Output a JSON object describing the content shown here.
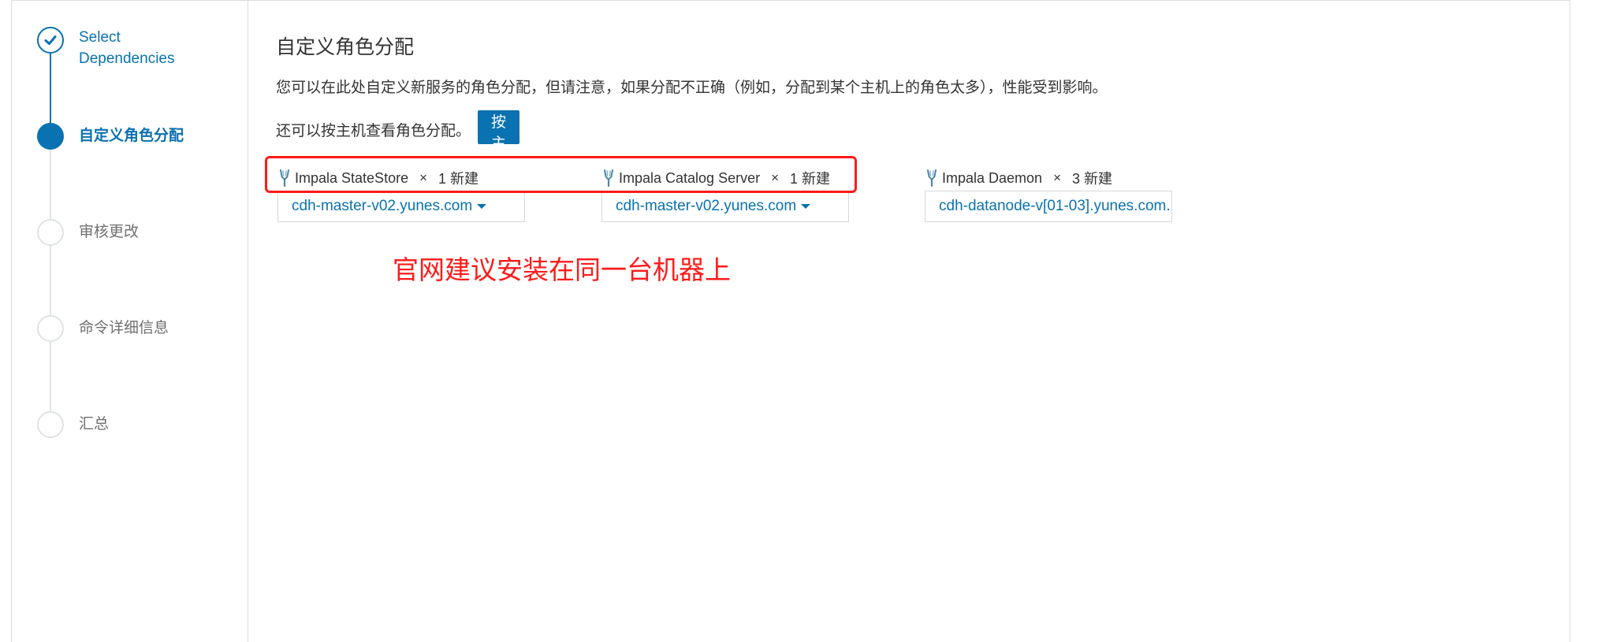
{
  "sidebar": {
    "steps": [
      {
        "label": "Select Dependencies",
        "state": "done"
      },
      {
        "label": "自定义角色分配",
        "state": "active"
      },
      {
        "label": "审核更改",
        "state": "todo"
      },
      {
        "label": "命令详细信息",
        "state": "todo"
      },
      {
        "label": "汇总",
        "state": "todo"
      }
    ]
  },
  "main": {
    "title": "自定义角色分配",
    "description": "您可以在此处自定义新服务的角色分配，但请注意，如果分配不正确（例如，分配到某个主机上的角色太多），性能受到影响。",
    "host_view_text": "还可以按主机查看角色分配。",
    "host_view_button": "按主机查看"
  },
  "roles": [
    {
      "name": "Impala StateStore",
      "times": "×",
      "count": "1 新建",
      "host": "cdh-master-v02.yunes.com",
      "has_dropdown": true
    },
    {
      "name": "Impala Catalog Server",
      "times": "×",
      "count": "1 新建",
      "host": "cdh-master-v02.yunes.com",
      "has_dropdown": true
    },
    {
      "name": "Impala Daemon",
      "times": "×",
      "count": "3 新建",
      "host": "cdh-datanode-v[01-03].yunes.com.",
      "has_dropdown": false
    }
  ],
  "annotation": {
    "text": "官网建议安装在同一台机器上",
    "color": "#ff1a1a"
  },
  "colors": {
    "accent": "#0a72b0",
    "annotation": "#ff1a1a",
    "step_inactive": "#dfe3e6"
  },
  "icons": {
    "step_done": "check-icon",
    "role": "impala-fork-icon",
    "dropdown": "caret-down-icon"
  }
}
